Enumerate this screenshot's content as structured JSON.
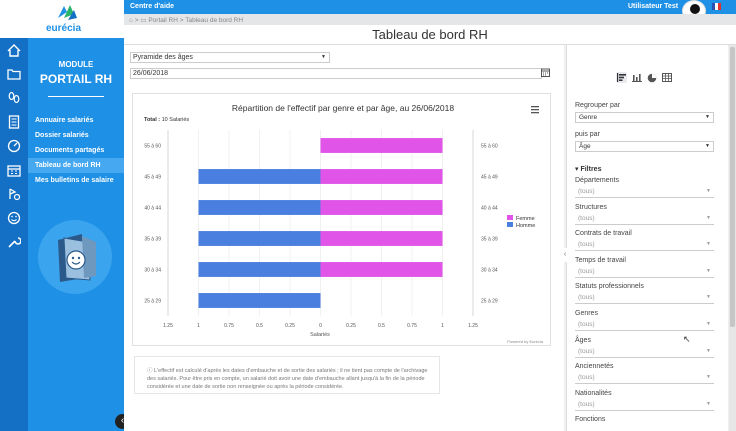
{
  "topbar": {
    "help": "Centre d'aide",
    "user": "Utilisateur Test"
  },
  "logo": {
    "brand": "eurécia"
  },
  "sidebar": {
    "module": "MODULE",
    "portal": "PORTAIL RH",
    "items": [
      {
        "label": "Annuaire salariés"
      },
      {
        "label": "Dossier salariés"
      },
      {
        "label": "Documents partagés"
      },
      {
        "label": "Tableau de bord RH"
      },
      {
        "label": "Mes bulletins de salaire"
      }
    ]
  },
  "breadcrumb": {
    "root": "Portail RH",
    "sep": " > ",
    "current": "Tableau de bord RH"
  },
  "page": {
    "title": "Tableau de bord RH"
  },
  "main": {
    "chart_select": "Pyramide des âges",
    "date": "26/06/2018",
    "note": "L'effectif est calculé d'après les dates d'embauche et de sortie des salariés ; il ne tient pas compte de l'archivage des salariés. Pour être pris en compte, un salarié doit avoir une date d'embauche allant jusqu'à la fin de la période considérée et une date de sortie non renseignée ou après la période considérée."
  },
  "chart_data": {
    "type": "bar",
    "title": "Répartition de l'effectif par genre et par âge, au 26/06/2018",
    "subtitle_label": "Total : ",
    "subtitle_value": "10 Salariés",
    "xlabel": "Salariés",
    "credit": "Powered by Eurécia",
    "categories": [
      "55 à 60",
      "45 à 49",
      "40 à 44",
      "35 à 39",
      "30 à 34",
      "25 à 29"
    ],
    "series": [
      {
        "name": "Femme",
        "color": "#e055e8",
        "values": [
          1,
          1,
          1,
          1,
          1,
          0
        ]
      },
      {
        "name": "Homme",
        "color": "#4a7fe0",
        "values": [
          0,
          1,
          1,
          1,
          1,
          1
        ]
      }
    ],
    "xticks": [
      "1.25",
      "1",
      "0.75",
      "0.5",
      "0.25",
      "0",
      "0.25",
      "0.5",
      "0.75",
      "1",
      "1.25"
    ],
    "xlim": [
      -1.25,
      1.25
    ],
    "legend_position": "right"
  },
  "panel": {
    "group_label": "Regrouper par",
    "group_value": "Genre",
    "then_label": "puis par",
    "then_value": "Âge",
    "filters_title": "▾ Filtres",
    "filters": [
      {
        "label": "Départements",
        "value": "(tous)"
      },
      {
        "label": "Structures",
        "value": "(tous)"
      },
      {
        "label": "Contrats de travail",
        "value": "(tous)"
      },
      {
        "label": "Temps de travail",
        "value": "(tous)"
      },
      {
        "label": "Statuts professionnels",
        "value": "(tous)"
      },
      {
        "label": "Genres",
        "value": "(tous)"
      },
      {
        "label": "Âges",
        "value": "(tous)"
      },
      {
        "label": "Anciennetés",
        "value": "(tous)"
      },
      {
        "label": "Nationalités",
        "value": "(tous)"
      },
      {
        "label": "Fonctions",
        "value": ""
      }
    ]
  }
}
